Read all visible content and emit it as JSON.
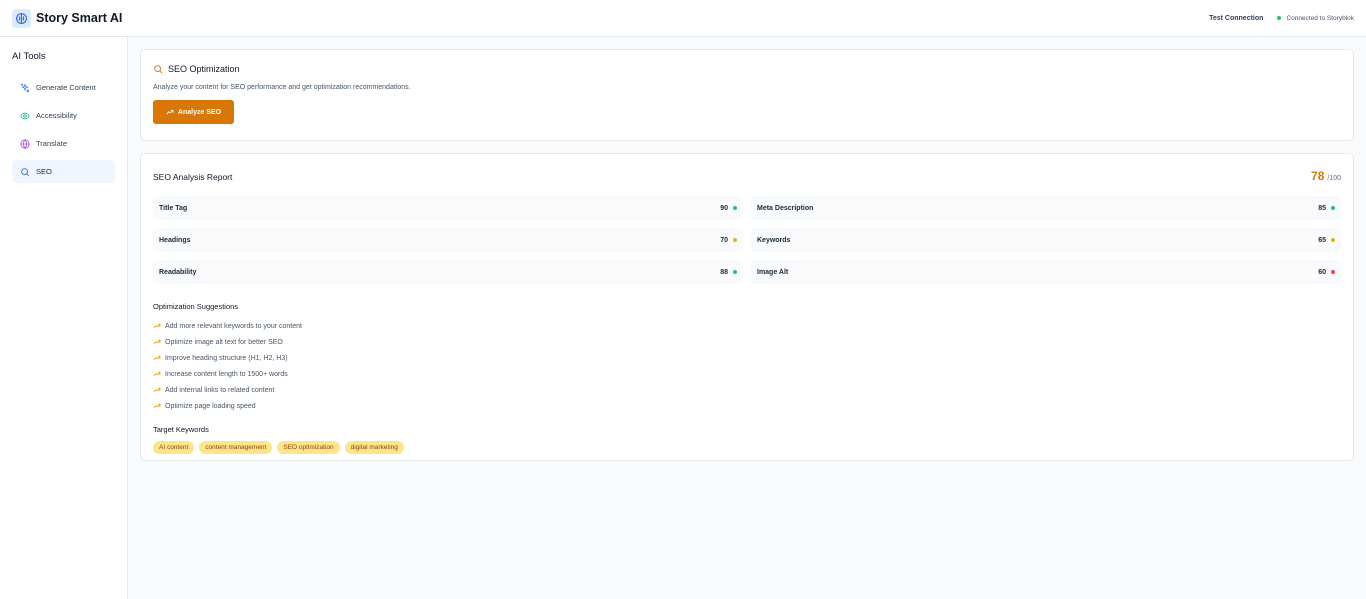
{
  "app": {
    "title": "Story Smart AI"
  },
  "header": {
    "test_connection": "Test Connection",
    "status": "Connected to Storyblok",
    "status_color": "#22c55e"
  },
  "sidebar": {
    "title": "AI Tools",
    "items": [
      {
        "label": "Generate Content",
        "icon": "sparkles-icon",
        "active": false
      },
      {
        "label": "Accessibility",
        "icon": "eye-icon",
        "active": false
      },
      {
        "label": "Translate",
        "icon": "globe-icon",
        "active": false
      },
      {
        "label": "SEO",
        "icon": "search-icon",
        "active": true
      }
    ]
  },
  "seo_card": {
    "title": "SEO Optimization",
    "description": "Analyze your content for SEO performance and get optimization recommendations.",
    "button_label": "Analyze SEO",
    "accent": "#d97706"
  },
  "report": {
    "title": "SEO Analysis Report",
    "score": "78",
    "score_max": "/100",
    "metrics": [
      {
        "label": "Title Tag",
        "value": "90",
        "status_color": "#22c55e"
      },
      {
        "label": "Meta Description",
        "value": "85",
        "status_color": "#22c55e"
      },
      {
        "label": "Headings",
        "value": "70",
        "status_color": "#eab308"
      },
      {
        "label": "Keywords",
        "value": "65",
        "status_color": "#eab308"
      },
      {
        "label": "Readability",
        "value": "88",
        "status_color": "#22c55e"
      },
      {
        "label": "Image Alt",
        "value": "60",
        "status_color": "#ef4444"
      }
    ],
    "suggestions_title": "Optimization Suggestions",
    "suggestions": [
      "Add more relevant keywords to your content",
      "Optimize image alt text for better SEO",
      "Improve heading structure (H1, H2, H3)",
      "Increase content length to 1500+ words",
      "Add internal links to related content",
      "Optimize page loading speed"
    ],
    "keywords_title": "Target Keywords",
    "keywords": [
      "AI content",
      "content management",
      "SEO optimization",
      "digital marketing"
    ]
  }
}
